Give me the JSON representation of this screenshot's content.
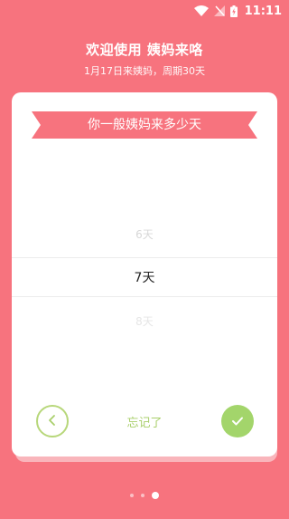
{
  "status_bar": {
    "time": "11:11"
  },
  "header": {
    "title": "欢迎使用 姨妈来咯",
    "subtitle": "1月17日来姨妈，周期30天"
  },
  "card": {
    "question": "你一般姨妈来多少天",
    "picker": {
      "prev": "6天",
      "selected": "7天",
      "next": "8天"
    },
    "forgot_label": "忘记了"
  },
  "pagination": {
    "total": 3,
    "active": 3
  },
  "colors": {
    "background": "#F7737E",
    "ribbon": "#F7737E",
    "accent_green": "#A3D56B",
    "outline_green": "#B7D77A"
  }
}
